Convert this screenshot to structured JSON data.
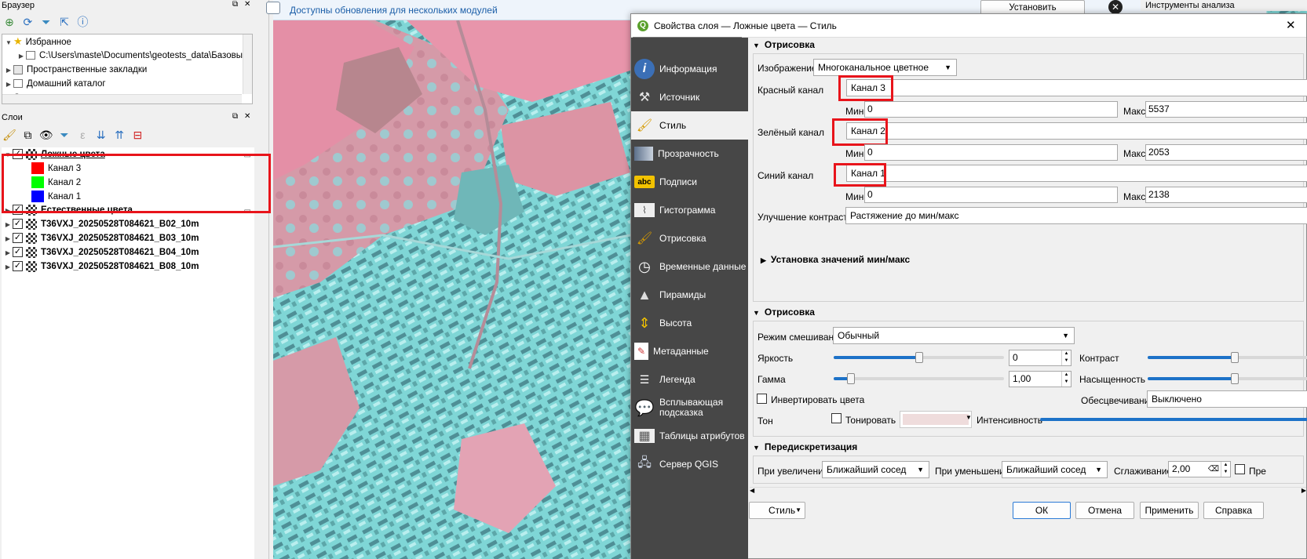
{
  "browser_panel": {
    "title": "Браузер",
    "items": [
      {
        "label": "Избранное"
      },
      {
        "label": "C:\\Users\\maste\\Documents\\geotests_data\\Базовые кар"
      },
      {
        "label": "Пространственные закладки"
      },
      {
        "label": "Домашний каталог"
      },
      {
        "label": "C:"
      }
    ]
  },
  "layers_panel": {
    "title": "Слои",
    "layers": [
      {
        "name": "Ложные цвета",
        "bands": [
          {
            "label": "Канал 3",
            "color": "#ff0000"
          },
          {
            "label": "Канал 2",
            "color": "#00ff00"
          },
          {
            "label": "Канал 1",
            "color": "#0000ff"
          }
        ]
      },
      {
        "name": "Естественные цвета"
      },
      {
        "name": "T36VXJ_20250528T084621_B02_10m"
      },
      {
        "name": "T36VXJ_20250528T084621_B03_10m"
      },
      {
        "name": "T36VXJ_20250528T084621_B04_10m"
      },
      {
        "name": "T36VXJ_20250528T084621_B08_10m"
      }
    ]
  },
  "notification": {
    "text": "Доступны обновления для нескольких модулей",
    "button": "Установить обновления...",
    "right_panel_title": "Инструменты анализа"
  },
  "dialog": {
    "title": "Свойства слоя — Ложные цвета — Стиль",
    "search_placeholder": "",
    "nav": [
      {
        "label": "Информация",
        "icon": "info-icon"
      },
      {
        "label": "Источник",
        "icon": "source-icon"
      },
      {
        "label": "Стиль",
        "icon": "paintbrush-icon"
      },
      {
        "label": "Прозрачность",
        "icon": "transparency-icon"
      },
      {
        "label": "Подписи",
        "icon": "labels-icon"
      },
      {
        "label": "Гистограмма",
        "icon": "histogram-icon"
      },
      {
        "label": "Отрисовка",
        "icon": "rendering-icon"
      },
      {
        "label": "Временные данные",
        "icon": "clock-icon"
      },
      {
        "label": "Пирамиды",
        "icon": "pyramid-icon"
      },
      {
        "label": "Высота",
        "icon": "elevation-icon"
      },
      {
        "label": "Метаданные",
        "icon": "metadata-icon"
      },
      {
        "label": "Легенда",
        "icon": "legend-icon"
      },
      {
        "label": "Всплывающая подсказка",
        "icon": "tooltip-icon"
      },
      {
        "label": "Таблицы атрибутов",
        "icon": "table-icon"
      },
      {
        "label": "Сервер QGIS",
        "icon": "server-icon"
      }
    ],
    "band_rendering": {
      "section": "Отрисовка",
      "render_type_label": "Изображение",
      "render_type": "Многоканальное цветное",
      "red_label": "Красный канал",
      "red_band": "Канал 3",
      "red_min": "0",
      "red_max": "5537",
      "green_label": "Зелёный канал",
      "green_band": "Канал 2",
      "green_min": "0",
      "green_max": "2053",
      "blue_label": "Синий канал",
      "blue_band": "Канал 1",
      "blue_min": "0",
      "blue_max": "2138",
      "min_label": "Мин",
      "max_label": "Макс",
      "contrast_label": "Улучшение контраста",
      "contrast": "Растяжение до мин/макс",
      "minmax_section": "Установка значений мин/макс"
    },
    "color_rendering": {
      "section": "Отрисовка",
      "blend_label": "Режим смешивания",
      "blend": "Обычный",
      "brightness_label": "Яркость",
      "brightness": "0",
      "brightness_level": 0.5,
      "contrast_label": "Контраст",
      "contrast_level": 0.5,
      "gamma_label": "Гамма",
      "gamma": "1,00",
      "gamma_level": 0.1,
      "saturation_label": "Насыщенность",
      "saturation_level": 0.5,
      "invert_label": "Инвертировать цвета",
      "grayscale_label": "Обесцвечивание",
      "grayscale": "Выключено",
      "hue_label": "Тон",
      "colorize_label": "Тонировать",
      "strength_label": "Интенсивность",
      "strength_level": 1.0
    },
    "resampling": {
      "section": "Передискретизация",
      "zoomin_label": "При увеличении",
      "zoomin": "Ближайший сосед",
      "zoomout_label": "При уменьшении",
      "zoomout": "Ближайший сосед",
      "oversampling_label": "Сглаживание",
      "oversampling": "2,00",
      "early_label": "Пре"
    },
    "buttons": {
      "style": "Стиль",
      "ok": "ОК",
      "cancel": "Отмена",
      "apply": "Применить",
      "help": "Справка"
    }
  }
}
